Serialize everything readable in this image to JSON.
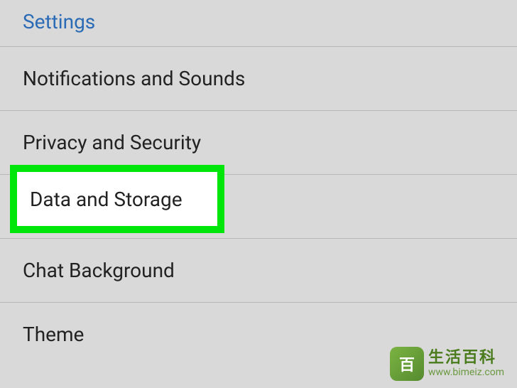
{
  "section_header": "Settings",
  "items": [
    {
      "label": "Notifications and Sounds",
      "value": ""
    },
    {
      "label": "Privacy and Security",
      "value": ""
    },
    {
      "label": "Data and Storage",
      "value": ""
    },
    {
      "label": "Chat Background",
      "value": ""
    },
    {
      "label": "Theme",
      "value": ""
    }
  ],
  "highlighted_item_label": "Data and Storage",
  "watermark": {
    "cn": "生活百科",
    "url": "www.bimeiz.com"
  }
}
